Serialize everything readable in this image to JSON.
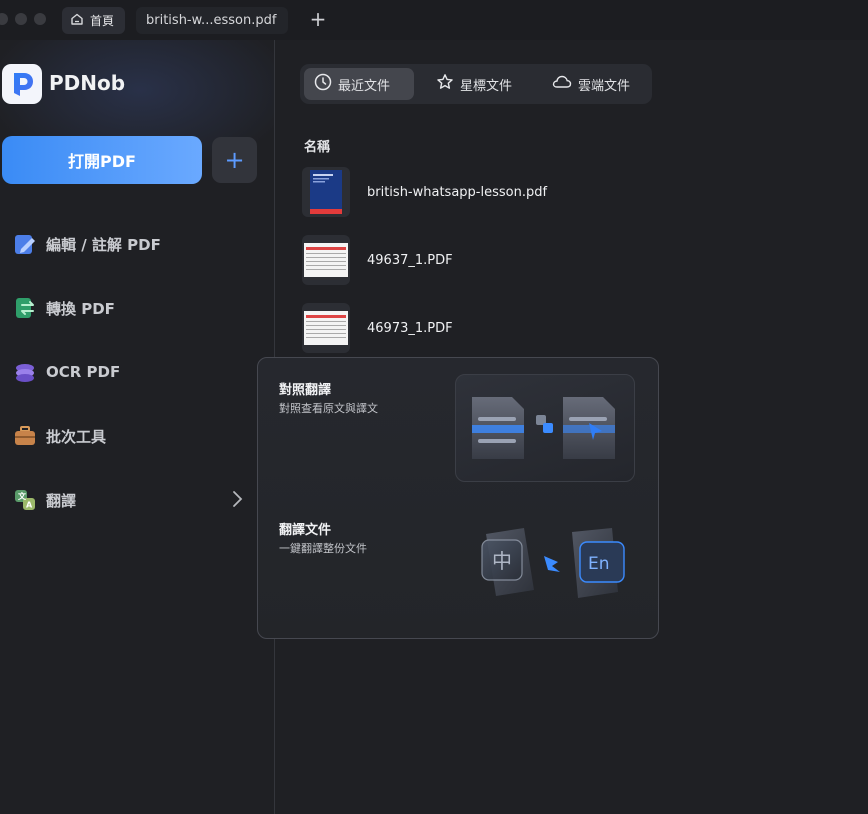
{
  "tabs": {
    "home_label": "首頁",
    "file_label": "british-w...esson.pdf",
    "add_symbol": "+"
  },
  "sidebar": {
    "app_name": "PDNob",
    "open_button": "打開PDF",
    "add_symbol": "+",
    "items": [
      {
        "label": "編輯 / 註解 PDF",
        "icon": "edit-icon"
      },
      {
        "label": "轉換 PDF",
        "icon": "convert-icon"
      },
      {
        "label": "OCR PDF",
        "icon": "ocr-icon"
      },
      {
        "label": "批次工具",
        "icon": "toolbox-icon"
      },
      {
        "label": "翻譯",
        "icon": "translate-icon"
      }
    ]
  },
  "main": {
    "tabs": [
      {
        "label": "最近文件",
        "icon": "clock-icon",
        "active": true
      },
      {
        "label": "星標文件",
        "icon": "star-icon",
        "active": false
      },
      {
        "label": "雲端文件",
        "icon": "cloud-icon",
        "active": false
      }
    ],
    "column_name": "名稱",
    "files": [
      {
        "name": "british-whatsapp-lesson.pdf"
      },
      {
        "name": "49637_1.PDF"
      },
      {
        "name": "46973_1.PDF"
      }
    ]
  },
  "translate_menu": {
    "items": [
      {
        "title": "對照翻譯",
        "subtitle": "對照查看原文與譯文"
      },
      {
        "title": "翻譯文件",
        "subtitle": "一鍵翻譯整份文件"
      }
    ],
    "illustration_text": {
      "source": "中",
      "target": "En"
    }
  },
  "colors": {
    "accent": "#3a8bf5",
    "background": "#1f2024",
    "sidebar": "#1f2024"
  }
}
